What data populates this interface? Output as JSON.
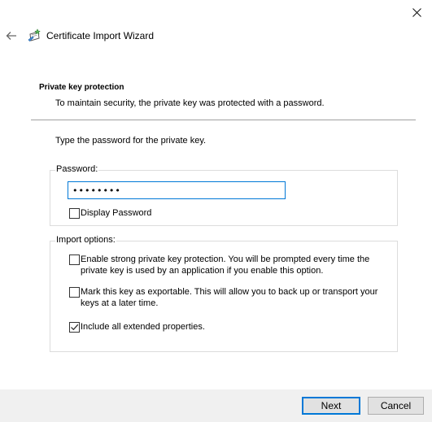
{
  "window": {
    "title": "Certificate Import Wizard",
    "close_symbol": "✕"
  },
  "header": {
    "heading": "Private key protection",
    "description": "To maintain security, the private key was protected with a password."
  },
  "instruction": "Type the password for the private key.",
  "password_group": {
    "label": "Password:",
    "value": "••••••••",
    "display_password_label": "Display Password",
    "display_password_checked": false
  },
  "import_options": {
    "label": "Import options:",
    "options": [
      {
        "line1": "Enable strong private key protection. You will be prompted every time the",
        "line2": "private key is used by an application if you enable this option.",
        "checked": false
      },
      {
        "line1": "Mark this key as exportable. This will allow you to back up or transport your",
        "line2": "keys at a later time.",
        "checked": false
      },
      {
        "line1": "Include all extended properties.",
        "checked": true
      }
    ]
  },
  "buttons": {
    "next": "Next",
    "cancel": "Cancel"
  },
  "colors": {
    "accent": "#0078d7",
    "footer_bg": "#f0f0f0",
    "button_bg": "#e1e1e1"
  },
  "icons": {
    "close": "close-icon",
    "back": "back-arrow-icon",
    "wizard": "certificate-wizard-icon",
    "checkmark": "checkmark-icon"
  }
}
